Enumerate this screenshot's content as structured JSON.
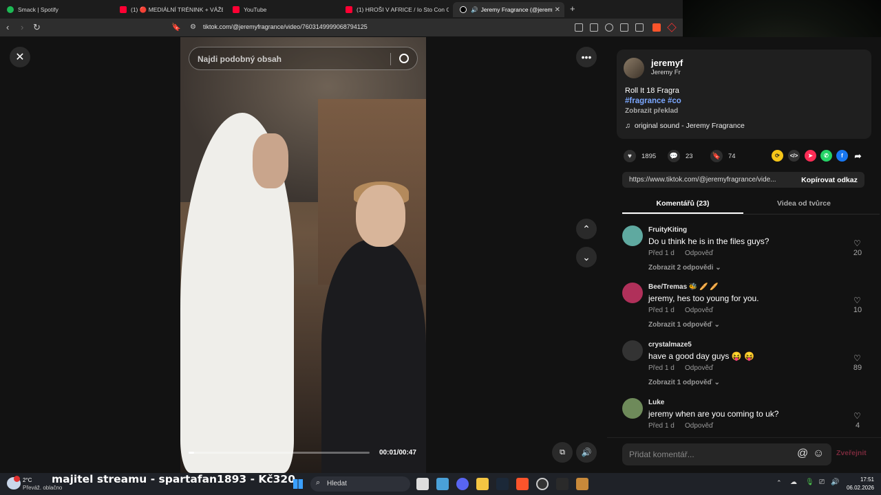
{
  "browser": {
    "tabs": [
      {
        "title": "Smack | Spotify",
        "color": "#1db954"
      },
      {
        "title": "(1) 🔴 MEDIÁLNÍ TRÉNINK + VÁŽEN",
        "color": "#ff0033"
      },
      {
        "title": "YouTube",
        "color": "#ff0033"
      },
      {
        "title": "(1) HROŠI V AFRICE / Io Sto Con Gli I",
        "color": "#ff0033"
      },
      {
        "title": "Jeremy Fragrance (@jeremyfr",
        "color": "#ffffff"
      }
    ],
    "new_tab": "+",
    "url": "tiktok.com/@jeremyfragrance/video/7603149999068794125"
  },
  "video": {
    "search_placeholder": "Najdi podobný obsah",
    "timecode": "00:01/00:47",
    "progress": 0.03
  },
  "post": {
    "username": "jeremyf",
    "nickname": "Jeremy Fr",
    "caption": "Roll It 18 Fragra",
    "tags": "#fragrance #co",
    "translate": "Zobrazit překlad",
    "sound": "original sound - Jeremy Fragrance"
  },
  "actions": {
    "likes": "1895",
    "comments": "23",
    "saves": "74"
  },
  "link": {
    "url": "https://www.tiktok.com/@jeremyfragrance/vide...",
    "copy_label": "Kopírovat odkaz"
  },
  "panel_tabs": {
    "comments": "Komentářů (23)",
    "videos": "Videa od tvůrce"
  },
  "comments": [
    {
      "user": "FruityKiting",
      "text": "Do u think he is in the files guys?",
      "time": "Před 1 d",
      "reply": "Odpověď",
      "more": "Zobrazit 2 odpovědi ⌄",
      "likes": "20",
      "color": "#5fa9a0"
    },
    {
      "user": "Bee/Tremas 🐝 🥖 🥖",
      "text": "jeremy, hes too young for you.",
      "time": "Před 1 d",
      "reply": "Odpověď",
      "more": "Zobrazit 1 odpověď ⌄",
      "likes": "10",
      "color": "#b0305a"
    },
    {
      "user": "crystalmaze5",
      "text": "have a good day guys 😝 😝",
      "time": "Před 1 d",
      "reply": "Odpověď",
      "more": "Zobrazit 1 odpověď ⌄",
      "likes": "89",
      "color": "#333333"
    },
    {
      "user": "Luke",
      "text": "jeremy when are you coming to uk?",
      "time": "Před 1 d",
      "reply": "Odpověď",
      "more": "",
      "likes": "4",
      "color": "#6e8a5a"
    }
  ],
  "comment_box": {
    "placeholder": "Přidat komentář...",
    "post_label": "Zveřejnit"
  },
  "taskbar": {
    "weather_temp": "2°C",
    "weather_desc": "Převáž. oblačno",
    "ticker": "majitel streamu - spartafan1893 - Kč320",
    "search_label": "Hledat",
    "time": "17:51",
    "date": "06.02.2026"
  }
}
